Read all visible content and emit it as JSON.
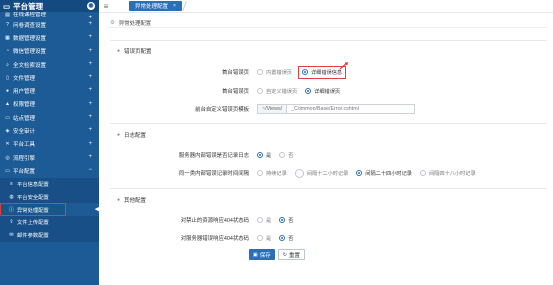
{
  "sidebar": {
    "title": "平台管理",
    "items": [
      {
        "label": "在线课程管理",
        "icon": "book-icon"
      },
      {
        "label": "问卷调查设置",
        "icon": "question-icon"
      },
      {
        "label": "数据管理设置",
        "icon": "data-icon"
      },
      {
        "label": "微信管理设置",
        "icon": "wechat-icon"
      },
      {
        "label": "全文检索设置",
        "icon": "search-icon"
      },
      {
        "label": "文件管理",
        "icon": "file-icon"
      },
      {
        "label": "用户管理",
        "icon": "user-icon"
      },
      {
        "label": "权限管理",
        "icon": "lock-icon"
      },
      {
        "label": "站点管理",
        "icon": "site-icon"
      },
      {
        "label": "安全审计",
        "icon": "shield-icon"
      },
      {
        "label": "平台工具",
        "icon": "wrench-icon"
      },
      {
        "label": "流程引擎",
        "icon": "flow-icon"
      },
      {
        "label": "平台配置",
        "icon": "config-icon"
      }
    ],
    "sub_items": [
      {
        "label": "平台信息配置",
        "icon": "info-icon"
      },
      {
        "label": "平台安全配置",
        "icon": "security-icon"
      },
      {
        "label": "异常处理配置",
        "icon": "warning-icon"
      },
      {
        "label": "文件上传配置",
        "icon": "upload-icon"
      },
      {
        "label": "邮件参数配置",
        "icon": "mail-icon"
      }
    ]
  },
  "topbar": {
    "tab_label": "异常处理配置"
  },
  "breadcrumb": "异常处理配置",
  "sections": {
    "error_page": {
      "title": "错误页配置",
      "row1": {
        "label": "首台错误页",
        "options": [
          "内置错误页",
          "详细错误信息"
        ]
      },
      "row2": {
        "label": "首台错误页",
        "options": [
          "自定义错误页",
          "详细错误页"
        ]
      },
      "row3": {
        "label": "前台自定义错误页模板",
        "addon": "~/Views/",
        "value": "_Common/Base/Error.cshtml"
      }
    },
    "log": {
      "title": "日志配置",
      "row1": {
        "label": "服务器内部错误是否记录日志",
        "options": [
          "是",
          "否"
        ]
      },
      "row2": {
        "label": "同一类内部错误记录时间间隔",
        "options": [
          "持续记录",
          "间隔十二小时记录",
          "间隔二十四小时记录",
          "间隔四十八小时记录"
        ]
      }
    },
    "other": {
      "title": "其他配置",
      "row1": {
        "label": "对禁止的资源响应404状态码",
        "options": [
          "是",
          "否"
        ]
      },
      "row2": {
        "label": "对服务器错误响应404状态码",
        "options": [
          "是",
          "否"
        ]
      }
    }
  },
  "buttons": {
    "save": "保存",
    "reset": "重置"
  },
  "colors": {
    "sidebar": "#1d5b96",
    "accent": "#2a6fb7",
    "highlight": "#e03a3a"
  }
}
